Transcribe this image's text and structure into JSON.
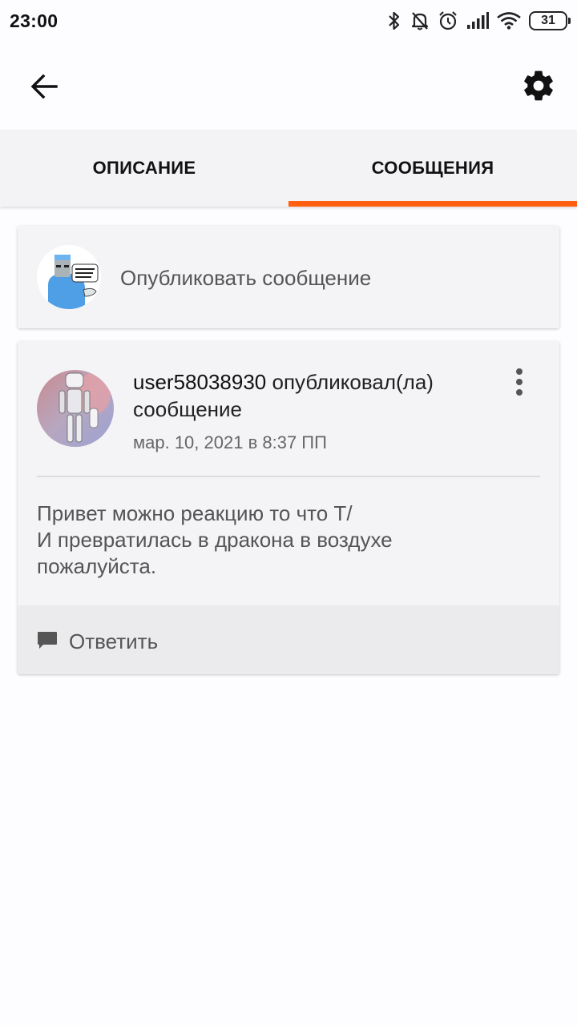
{
  "status_bar": {
    "time": "23:00",
    "battery": "31",
    "icons": [
      "bluetooth-icon",
      "notifications-off-icon",
      "alarm-icon",
      "signal-icon",
      "wifi-icon",
      "battery-icon"
    ]
  },
  "toolbar": {
    "back_icon": "arrow-back-icon",
    "settings_icon": "gear-icon"
  },
  "tabs": [
    {
      "label": "ОПИСАНИЕ",
      "active": false
    },
    {
      "label": "СООБЩЕНИЯ",
      "active": true
    }
  ],
  "compose": {
    "placeholder": "Опубликовать сообщение",
    "avatar_icon": "user-avatar"
  },
  "post": {
    "username": "user58038930",
    "action": " опубликовал(ла) сообщение",
    "date": "мар. 10, 2021 в 8:37 ПП",
    "body_lines": [
      "Привет можно реакцию то что Т/",
      "И превратилась в дракона в воздухе",
      "пожалуйста."
    ],
    "more_icon": "more-vertical-icon",
    "reply_label": "Ответить",
    "reply_icon": "comment-icon"
  },
  "colors": {
    "accent": "#ff5f0f",
    "background": "#fdfcff",
    "card": "#f4f3f6",
    "tabbar": "#f3f2f5"
  }
}
